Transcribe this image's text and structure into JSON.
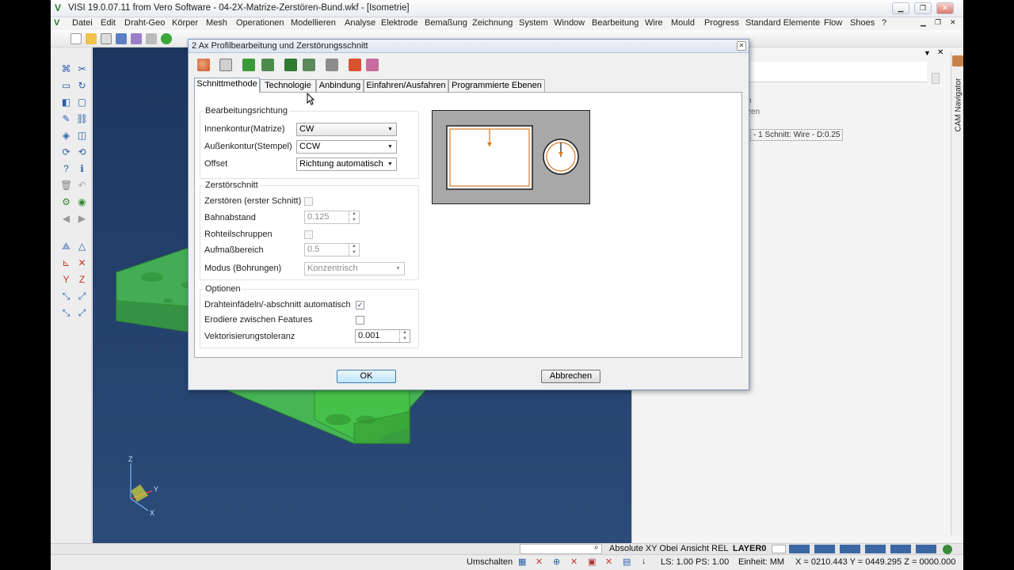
{
  "window": {
    "title": "VISI 19.0.07.11 from Vero Software - 04-2X-Matrize-Zerstören-Bund.wkf - [Isometrie]",
    "minimize": "▁",
    "restore": "❐",
    "close": "✕",
    "inner_minimize": "▁",
    "inner_restore": "❐",
    "inner_close": "✕"
  },
  "menu": [
    "Datei",
    "Edit",
    "Draht-Geo",
    "Körper",
    "Mesh",
    "Operationen",
    "Modellieren",
    "Analyse",
    "Elektrode",
    "Bemaßung",
    "Zeichnung",
    "System",
    "Window",
    "Bearbeitung",
    "Wire",
    "Mould",
    "Progress",
    "Standard Elemente",
    "Flow",
    "Shoes",
    "?"
  ],
  "right_panel": {
    "pin": "▼",
    "close": "✕",
    "vertical_tab": "CAM Navigator",
    "partial_line_1": "n",
    "partial_line_2": "zen",
    "tree_item": "- 1 Schnitt: Wire - D:0.25"
  },
  "dialog": {
    "title": "2 Ax Profilbearbeitung und Zerstörungsschnitt",
    "close": "✕",
    "tabs": [
      "Schnittmethode",
      "Technologie",
      "Anbindung",
      "Einfahren/Ausfahren",
      "Programmierte Ebenen"
    ],
    "active_tab": "Schnittmethode",
    "groups": {
      "bearbeitungsrichtung": {
        "title": "Bearbeitungsrichtung",
        "innenkontur_label": "Innenkontur(Matrize)",
        "innenkontur_value": "CW",
        "aussenkontur_label": "Außenkontur(Stempel)",
        "aussenkontur_value": "CCW",
        "offset_label": "Offset",
        "offset_value": "Richtung automatisch"
      },
      "zerstoerschnitt": {
        "title": "Zerstörschnitt",
        "zerstoeren_label": "Zerstören (erster Schnitt)",
        "bahnabstand_label": "Bahnabstand",
        "bahnabstand_value": "0.125",
        "rohteil_label": "Rohteilschruppen",
        "aufmass_label": "Aufmaßbereich",
        "aufmass_value": "0.5",
        "modus_label": "Modus (Bohrungen)",
        "modus_value": "Konzentrisch"
      },
      "optionen": {
        "title": "Optionen",
        "draht_label": "Drahteinfädeln/-abschnitt automatisch",
        "draht_checked": "✓",
        "erodiere_label": "Erodiere zwischen Features",
        "vektor_label": "Vektorisierungstoleranz",
        "vektor_value": "0.001"
      }
    },
    "ok": "OK",
    "cancel": "Abbrechen"
  },
  "statusbar": {
    "absolute": "Absolute XY Obei",
    "ansicht": "Ansicht REL",
    "layer": "LAYER0",
    "umschalten": "Umschalten",
    "ls": "LS: 1.00 PS: 1.00",
    "einheit": "Einheit: MM",
    "coords": "X = 0210.443 Y = 0449.295 Z = 0000.000"
  },
  "axes": {
    "z": "Z",
    "y": "Y",
    "x": "X"
  },
  "colors": {
    "viewport_bg": "#1d3a63",
    "model_green": "#3fcb3f",
    "contour_orange": "#d9781e",
    "accent_blue": "#2c5fa8"
  }
}
